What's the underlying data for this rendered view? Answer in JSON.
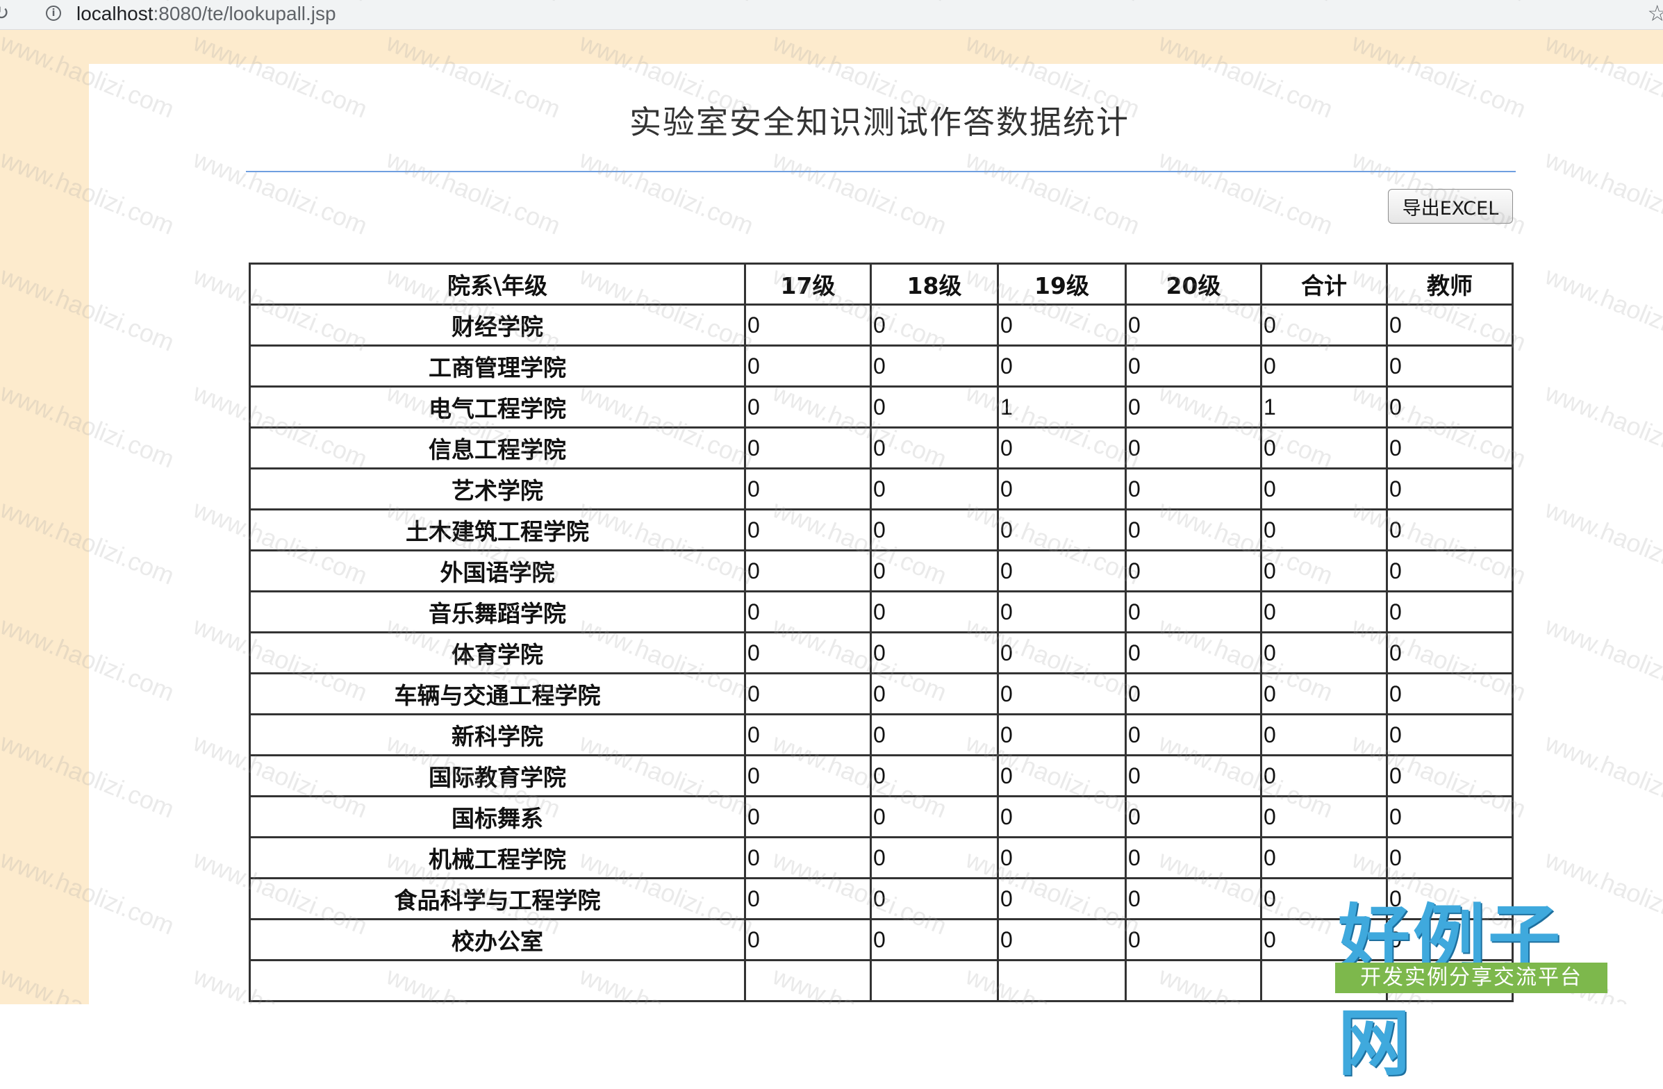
{
  "browser": {
    "url_host": "localhost",
    "url_rest": ":8080/te/lookupall.jsp"
  },
  "page": {
    "title": "实验室安全知识测试作答数据统计",
    "export_label": "导出EXCEL"
  },
  "table": {
    "headers": [
      "院系\\年级",
      "17级",
      "18级",
      "19级",
      "20级",
      "合计",
      "教师"
    ],
    "rows": [
      {
        "dept": "财经学院",
        "values": [
          "0",
          "0",
          "0",
          "0",
          "0",
          "0"
        ]
      },
      {
        "dept": "工商管理学院",
        "values": [
          "0",
          "0",
          "0",
          "0",
          "0",
          "0"
        ]
      },
      {
        "dept": "电气工程学院",
        "values": [
          "0",
          "0",
          "1",
          "0",
          "1",
          "0"
        ]
      },
      {
        "dept": "信息工程学院",
        "values": [
          "0",
          "0",
          "0",
          "0",
          "0",
          "0"
        ]
      },
      {
        "dept": "艺术学院",
        "values": [
          "0",
          "0",
          "0",
          "0",
          "0",
          "0"
        ]
      },
      {
        "dept": "土木建筑工程学院",
        "values": [
          "0",
          "0",
          "0",
          "0",
          "0",
          "0"
        ]
      },
      {
        "dept": "外国语学院",
        "values": [
          "0",
          "0",
          "0",
          "0",
          "0",
          "0"
        ]
      },
      {
        "dept": "音乐舞蹈学院",
        "values": [
          "0",
          "0",
          "0",
          "0",
          "0",
          "0"
        ]
      },
      {
        "dept": "体育学院",
        "values": [
          "0",
          "0",
          "0",
          "0",
          "0",
          "0"
        ]
      },
      {
        "dept": "车辆与交通工程学院",
        "values": [
          "0",
          "0",
          "0",
          "0",
          "0",
          "0"
        ]
      },
      {
        "dept": "新科学院",
        "values": [
          "0",
          "0",
          "0",
          "0",
          "0",
          "0"
        ]
      },
      {
        "dept": "国际教育学院",
        "values": [
          "0",
          "0",
          "0",
          "0",
          "0",
          "0"
        ]
      },
      {
        "dept": "国标舞系",
        "values": [
          "0",
          "0",
          "0",
          "0",
          "0",
          "0"
        ]
      },
      {
        "dept": "机械工程学院",
        "values": [
          "0",
          "0",
          "0",
          "0",
          "0",
          "0"
        ]
      },
      {
        "dept": "食品科学与工程学院",
        "values": [
          "0",
          "0",
          "0",
          "0",
          "0",
          "0"
        ]
      },
      {
        "dept": "校办公室",
        "values": [
          "0",
          "0",
          "0",
          "0",
          "0",
          "0"
        ]
      },
      {
        "dept": "",
        "values": [
          "",
          "",
          "",
          "",
          "",
          ""
        ]
      }
    ]
  },
  "watermark": {
    "text": "www.haolizi.com"
  },
  "logo": {
    "main": "好例子网",
    "sub": "开发实例分享交流平台"
  }
}
